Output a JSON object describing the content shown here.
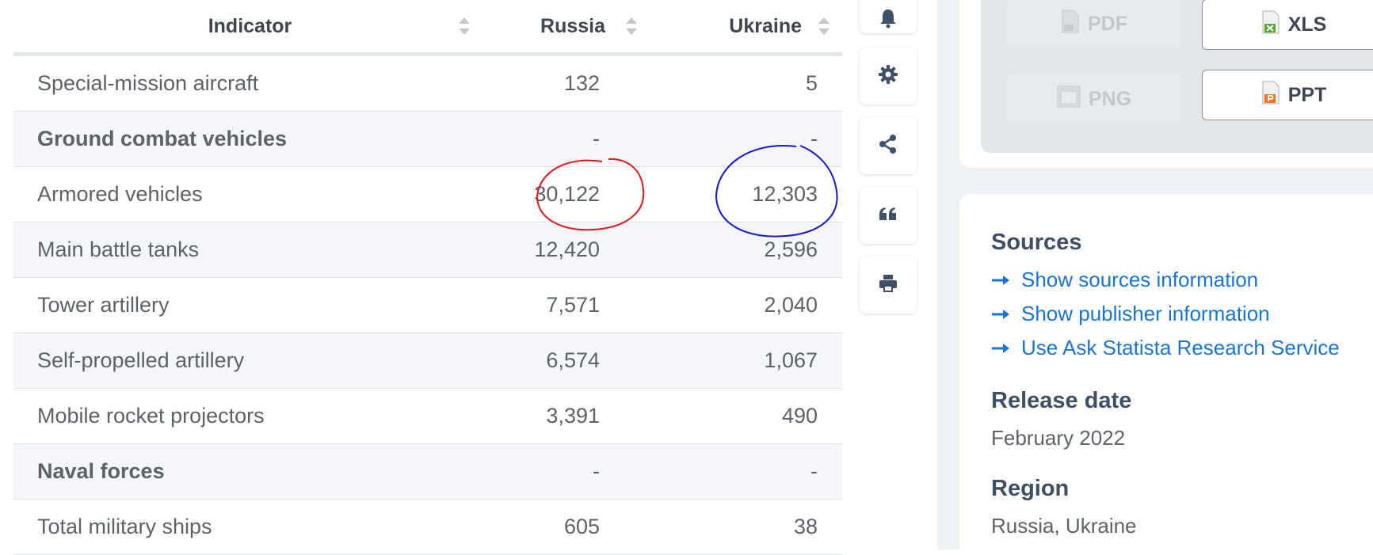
{
  "table": {
    "headers": {
      "indicator": "Indicator",
      "russia": "Russia",
      "ukraine": "Ukraine"
    },
    "rows": [
      {
        "indicator": "Special-mission aircraft",
        "russia": "132",
        "ukraine": "5",
        "group": false
      },
      {
        "indicator": "Ground combat vehicles",
        "russia": "-",
        "ukraine": "-",
        "group": true
      },
      {
        "indicator": "Armored vehicles",
        "russia": "30,122",
        "ukraine": "12,303",
        "group": false
      },
      {
        "indicator": "Main battle tanks",
        "russia": "12,420",
        "ukraine": "2,596",
        "group": false
      },
      {
        "indicator": "Tower artillery",
        "russia": "7,571",
        "ukraine": "2,040",
        "group": false
      },
      {
        "indicator": "Self-propelled artillery",
        "russia": "6,574",
        "ukraine": "1,067",
        "group": false
      },
      {
        "indicator": "Mobile rocket projectors",
        "russia": "3,391",
        "ukraine": "490",
        "group": false
      },
      {
        "indicator": "Naval forces",
        "russia": "-",
        "ukraine": "-",
        "group": true
      },
      {
        "indicator": "Total military ships",
        "russia": "605",
        "ukraine": "38",
        "group": false
      }
    ]
  },
  "annotations": {
    "russia_circle_color": "#e0161b",
    "ukraine_circle_color": "#1316d6"
  },
  "tools": [
    "bell-icon",
    "gear-icon",
    "share-icon",
    "quote-icon",
    "print-icon"
  ],
  "downloads": {
    "pdf": "PDF",
    "xls": "XLS",
    "png": "PNG",
    "ppt": "PPT"
  },
  "info": {
    "sources_heading": "Sources",
    "links": [
      "Show sources information",
      "Show publisher information",
      "Use Ask Statista Research Service"
    ],
    "release_heading": "Release date",
    "release_value": "February 2022",
    "region_heading": "Region",
    "region_value": "Russia, Ukraine"
  },
  "colors": {
    "link": "#1a74d3",
    "heading": "#3f4f63",
    "accent_xls": "#5aa532",
    "accent_ppt": "#e8742a"
  }
}
